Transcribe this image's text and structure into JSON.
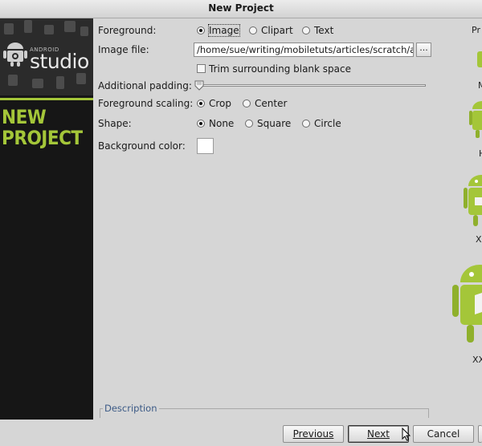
{
  "window": {
    "title": "New Project"
  },
  "sidebar": {
    "logo_small": "ANDROID",
    "logo_big": "studio",
    "heading_line1": "NEW",
    "heading_line2": "PROJECT",
    "accent_color": "#a4c639"
  },
  "form": {
    "foreground": {
      "label": "Foreground:",
      "options": [
        "Image",
        "Clipart",
        "Text"
      ],
      "selected": "Image"
    },
    "image_file": {
      "label": "Image file:",
      "value": "/home/sue/writing/mobiletuts/articles/scratch/and",
      "browse_label": "..."
    },
    "trim": {
      "label": "Trim surrounding blank space",
      "checked": false
    },
    "padding": {
      "label": "Additional padding:",
      "value_percent": 0
    },
    "scaling": {
      "label": "Foreground scaling:",
      "options": [
        "Crop",
        "Center"
      ],
      "selected": "Crop"
    },
    "shape": {
      "label": "Shape:",
      "options": [
        "None",
        "Square",
        "Circle"
      ],
      "selected": "None"
    },
    "background_color": {
      "label": "Background color:",
      "value": "#ffffff"
    }
  },
  "preview": {
    "header": "Pr",
    "labels": [
      "M",
      "H",
      "X",
      "XX"
    ]
  },
  "description": {
    "label": "Description"
  },
  "buttons": {
    "previous": "Previous",
    "next": "Next",
    "cancel": "Cancel"
  }
}
